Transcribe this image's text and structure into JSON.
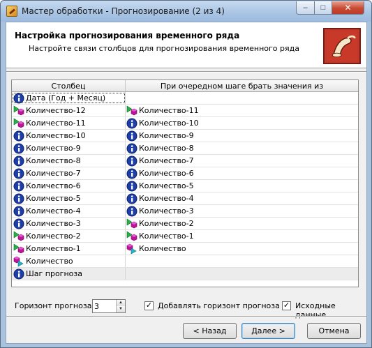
{
  "window": {
    "title": "Мастер обработки - Прогнозирование (2 из 4)",
    "controls": {
      "minimize": "–",
      "maximize": "□",
      "close": "✕"
    }
  },
  "header": {
    "title": "Настройка прогнозирования временного ряда",
    "subtitle": "Настройте связи столбцов для прогнозирования временного ряда"
  },
  "grid": {
    "columns": [
      "Столбец",
      "При очередном шаге брать значения из"
    ],
    "rows": [
      {
        "col": "Дата (Год + Месяц)",
        "col_icon": "info-icon",
        "src": "",
        "src_icon": ""
      },
      {
        "col": "Количество-12",
        "col_icon": "input-output-icon",
        "src": "Количество-11",
        "src_icon": "input-output-icon"
      },
      {
        "col": "Количество-11",
        "col_icon": "input-output-icon",
        "src": "Количество-10",
        "src_icon": "info-icon"
      },
      {
        "col": "Количество-10",
        "col_icon": "info-icon",
        "src": "Количество-9",
        "src_icon": "info-icon"
      },
      {
        "col": "Количество-9",
        "col_icon": "info-icon",
        "src": "Количество-8",
        "src_icon": "info-icon"
      },
      {
        "col": "Количество-8",
        "col_icon": "info-icon",
        "src": "Количество-7",
        "src_icon": "info-icon"
      },
      {
        "col": "Количество-7",
        "col_icon": "info-icon",
        "src": "Количество-6",
        "src_icon": "info-icon"
      },
      {
        "col": "Количество-6",
        "col_icon": "info-icon",
        "src": "Количество-5",
        "src_icon": "info-icon"
      },
      {
        "col": "Количество-5",
        "col_icon": "info-icon",
        "src": "Количество-4",
        "src_icon": "info-icon"
      },
      {
        "col": "Количество-4",
        "col_icon": "info-icon",
        "src": "Количество-3",
        "src_icon": "info-icon"
      },
      {
        "col": "Количество-3",
        "col_icon": "info-icon",
        "src": "Количество-2",
        "src_icon": "input-output-icon"
      },
      {
        "col": "Количество-2",
        "col_icon": "input-output-icon",
        "src": "Количество-1",
        "src_icon": "input-output-icon"
      },
      {
        "col": "Количество-1",
        "col_icon": "input-output-icon",
        "src": "Количество",
        "src_icon": "output-input-icon"
      },
      {
        "col": "Количество",
        "col_icon": "output-input-icon",
        "src": "",
        "src_icon": ""
      },
      {
        "col": "Шаг прогноза",
        "col_icon": "info-icon",
        "src": "",
        "src_icon": ""
      }
    ]
  },
  "options": {
    "horizon_label": "Горизонт прогноза",
    "horizon_value": "3",
    "add_horizon_label": "Добавлять горизонт прогноза",
    "add_horizon_checked": true,
    "source_data_label": "Исходные данные",
    "source_data_checked": true
  },
  "buttons": {
    "back": "< Назад",
    "next": "Далее >",
    "cancel": "Отмена"
  },
  "colors": {
    "info": "#1f3fa8",
    "green_arrow": "#2ab04a",
    "magenta_cube": "#c0129c",
    "cyan_arrow": "#1fb7c9"
  }
}
